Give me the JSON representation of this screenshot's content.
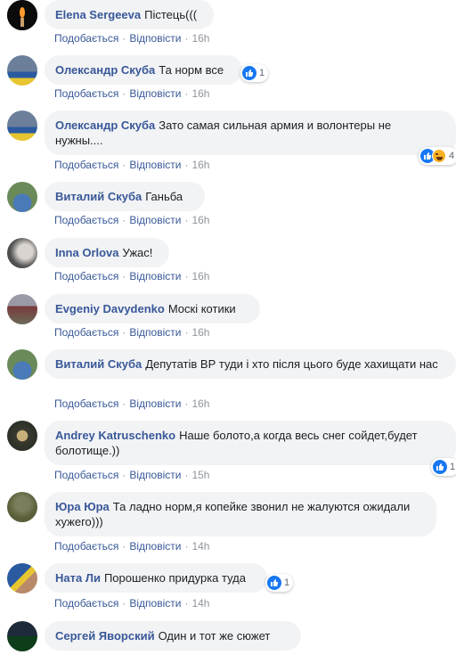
{
  "action_like": "Подобається",
  "action_reply": "Відповісти",
  "comments": [
    {
      "author": "Elena Sergeeva",
      "text": "Пістець(((",
      "time": "16h"
    },
    {
      "author": "Олександр Скуба",
      "text": "Та норм все",
      "time": "16h",
      "reaction_count": "1"
    },
    {
      "author": "Олександр Скуба",
      "text": "Зато самая сильная армия и волонтеры не нужны....",
      "time": "16h",
      "reaction_count": "4"
    },
    {
      "author": "Виталий Скуба",
      "text": "Ганьба",
      "time": "16h"
    },
    {
      "author": "Inna Orlova",
      "text": "Ужас!",
      "time": "16h"
    },
    {
      "author": "Evgeniy Davydenko",
      "text": "Москі котики",
      "time": "16h"
    },
    {
      "author": "Виталий Скуба",
      "text": "Депутатів ВР туди і хто після цього буде хахищати нас",
      "time": "16h"
    },
    {
      "author": "Andrey Katruschenko",
      "text": "Наше болото,а когда весь снег сойдет,будет болотище.))",
      "time": "15h",
      "reaction_count": "1"
    },
    {
      "author": "Юра Юра",
      "text": "Та ладно норм,я копейке звонил не жалуются ожидали хужего)))",
      "time": "14h"
    },
    {
      "author": "Ната Ли",
      "text": "Порошенко придурка туда",
      "time": "14h",
      "reaction_count": "1"
    },
    {
      "author": "Сергей Яворский",
      "text": "Один и тот же сюжет"
    }
  ]
}
